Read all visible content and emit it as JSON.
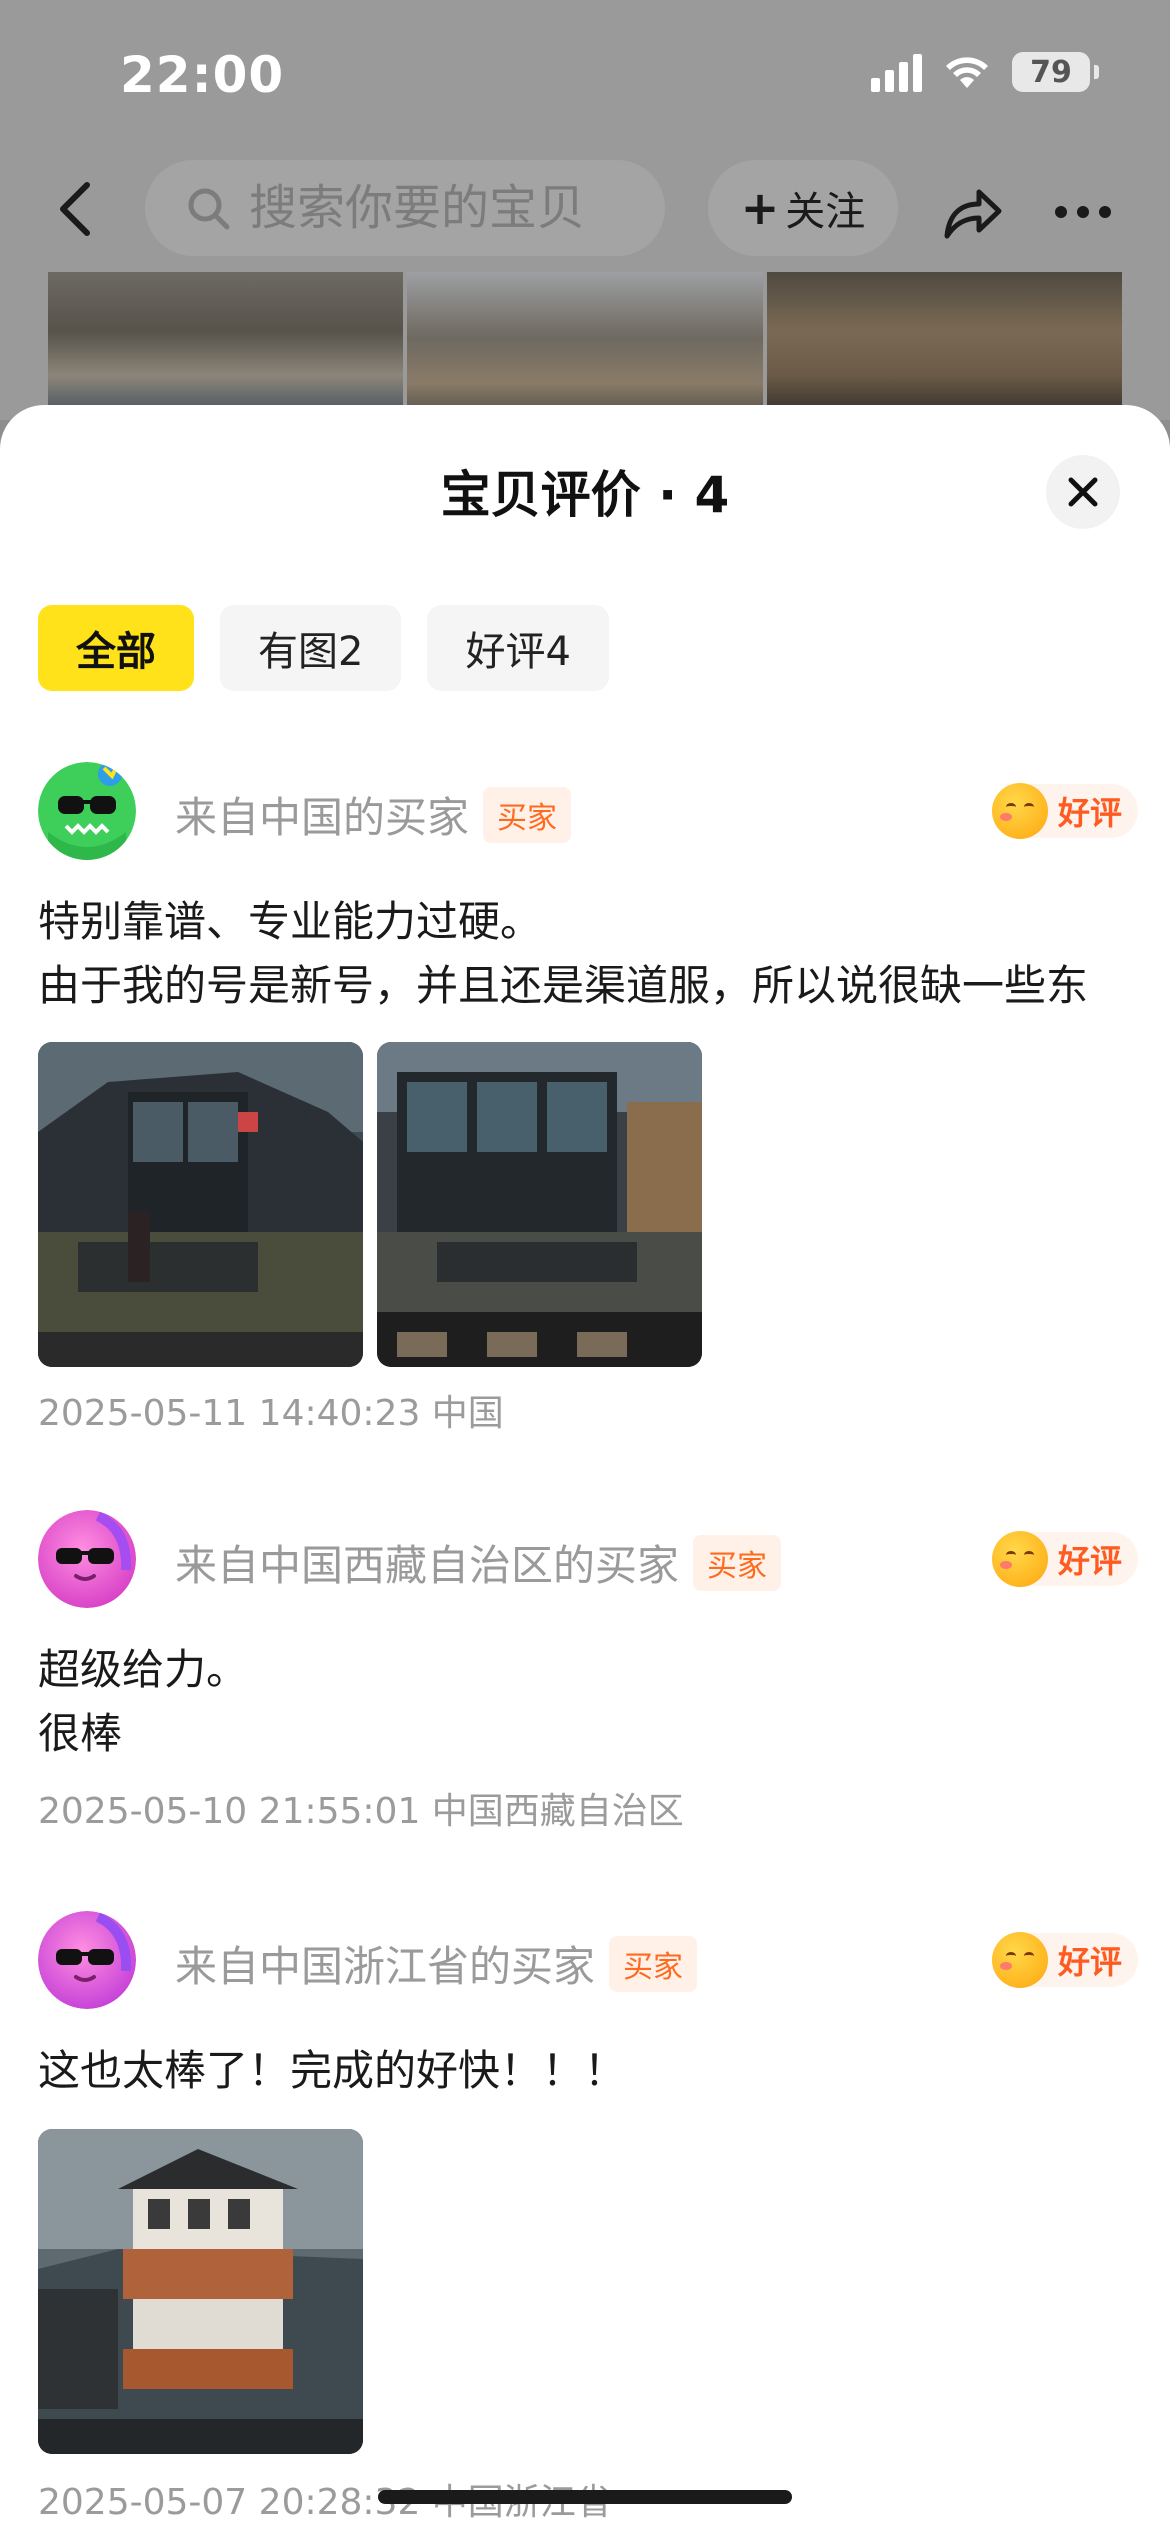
{
  "status_bar": {
    "time": "22:00",
    "battery": "79"
  },
  "nav": {
    "search_placeholder": "搜索你要的宝贝",
    "follow_label": "关注"
  },
  "sheet": {
    "title": "宝贝评价 · 4",
    "filters": [
      {
        "label": "全部",
        "active": true
      },
      {
        "label": "有图2",
        "active": false
      },
      {
        "label": "好评4",
        "active": false
      }
    ]
  },
  "reviews": [
    {
      "buyer": "来自中国的买家",
      "tag": "买家",
      "rating_label": "好评",
      "text": "特别靠谱、专业能力过硬。\n由于我的号是新号，并且还是渠道服，所以说很缺一些东",
      "date_location": "2025-05-11 14:40:23 中国",
      "avatar": "green-monster-avatar"
    },
    {
      "buyer": "来自中国西藏自治区的买家",
      "tag": "买家",
      "rating_label": "好评",
      "text": "超级给力。\n很棒",
      "date_location": "2025-05-10 21:55:01 中国西藏自治区",
      "avatar": "pink-sunglasses-avatar"
    },
    {
      "buyer": "来自中国浙江省的买家",
      "tag": "买家",
      "rating_label": "好评",
      "text": "这也太棒了！完成的好快！！！",
      "date_location": "2025-05-07 20:28:32 中国浙江省",
      "avatar": "purple-sunglasses-avatar"
    }
  ],
  "colors": {
    "accent_yellow": "#ffe21a",
    "tag_orange": "#ff6a1f",
    "good_red": "#ff5a1f"
  }
}
